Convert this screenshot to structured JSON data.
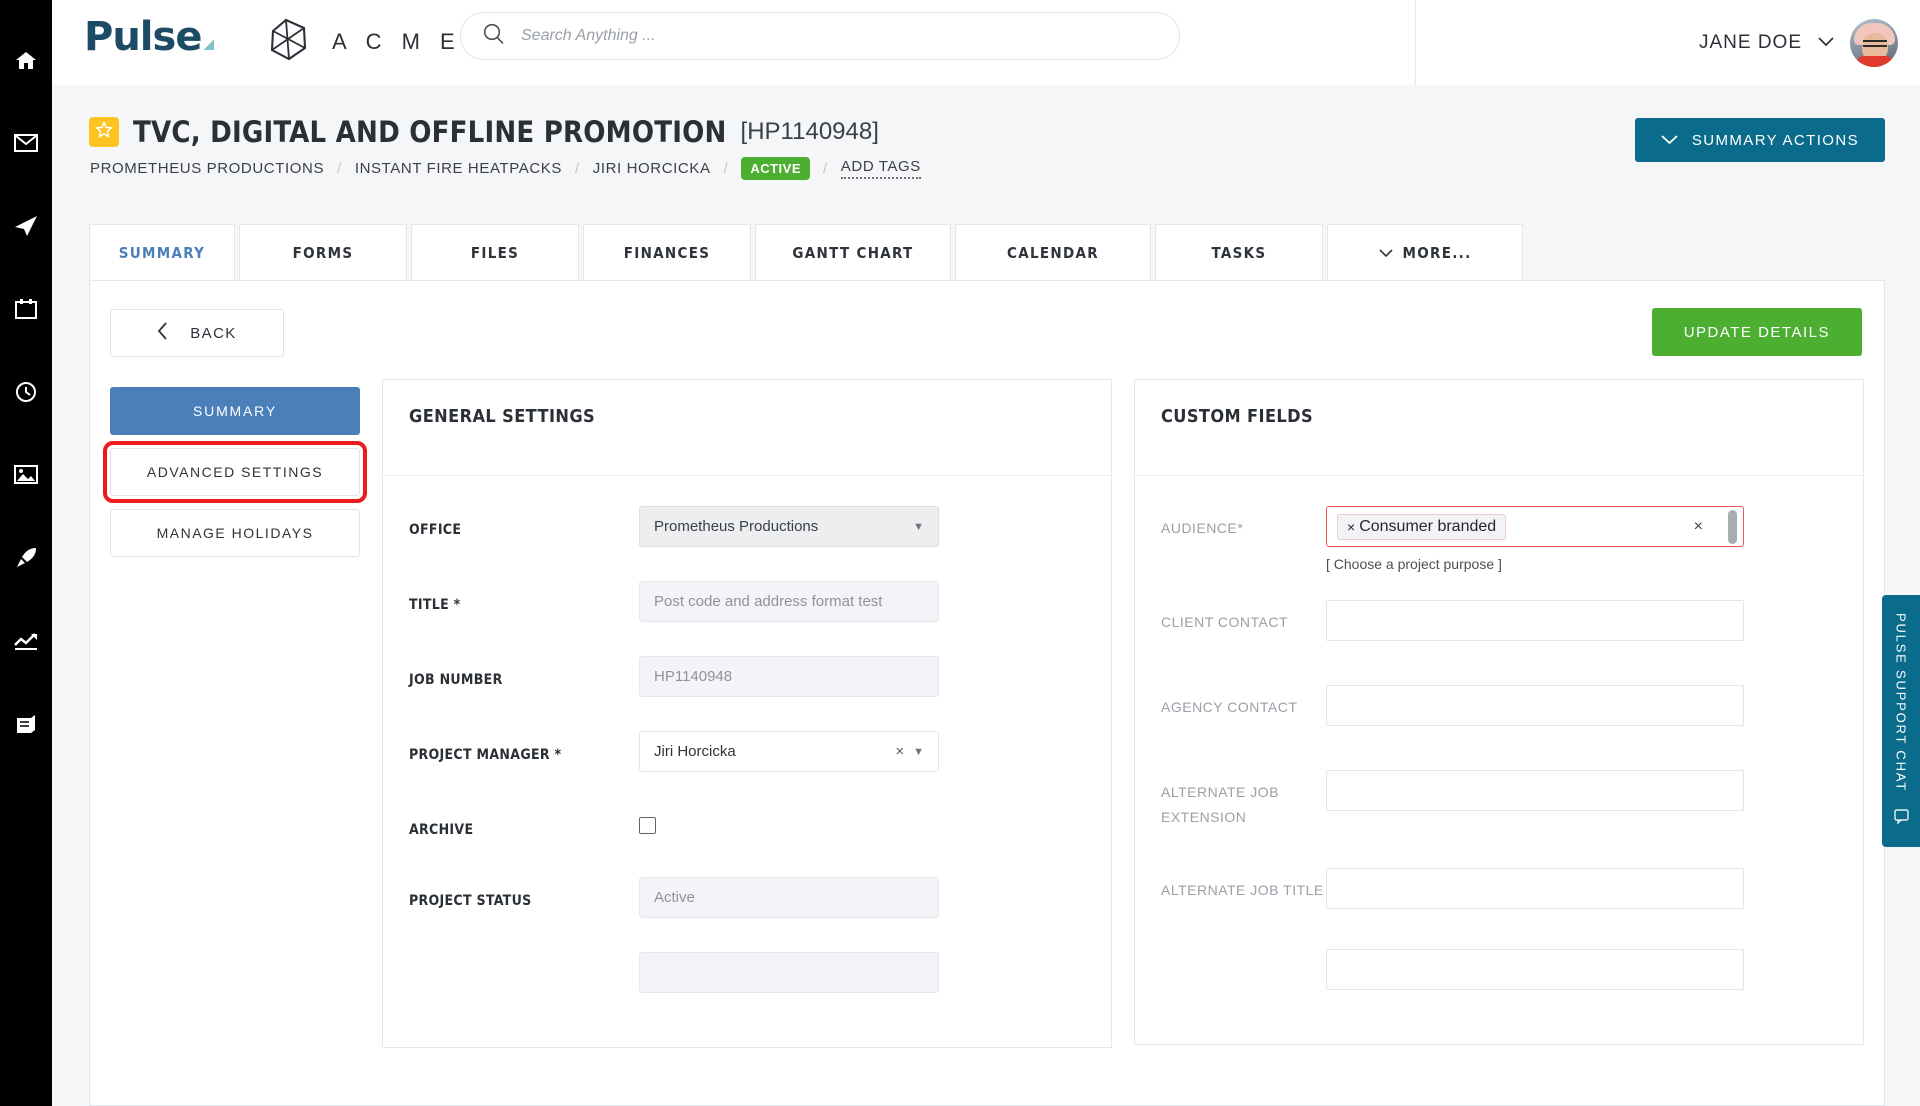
{
  "rail": {
    "items": [
      {
        "name": "home-icon",
        "label": "Home"
      },
      {
        "name": "mail-icon",
        "label": "Mail"
      },
      {
        "name": "send-icon",
        "label": "Send"
      },
      {
        "name": "calendar-icon",
        "label": "Calendar"
      },
      {
        "name": "timer-icon",
        "label": "Timer"
      },
      {
        "name": "image-icon",
        "label": "Media"
      },
      {
        "name": "rocket-icon",
        "label": "Launch"
      },
      {
        "name": "chart-icon",
        "label": "Reports"
      },
      {
        "name": "book-icon",
        "label": "Library"
      }
    ]
  },
  "topbar": {
    "logo_text": "Pulse",
    "brand_name": "A C M E",
    "brand_icon": "polyhedron-logo",
    "search": {
      "placeholder": "Search Anything ...",
      "value": "",
      "icon": "search-icon"
    },
    "user": {
      "name": "JANE DOE",
      "chevron": "chevron-down-icon",
      "avatar": "user-avatar"
    }
  },
  "page_header": {
    "star_icon": "star-icon",
    "title": "TVC, DIGITAL AND OFFLINE PROMOTION",
    "code": "[HP1140948]",
    "breadcrumbs": [
      {
        "label": "PROMETHEUS PRODUCTIONS",
        "type": "link"
      },
      {
        "label": "INSTANT FIRE HEATPACKS",
        "type": "link"
      },
      {
        "label": "JIRI HORCICKA",
        "type": "link"
      },
      {
        "label": "ACTIVE",
        "type": "badge"
      },
      {
        "label": "ADD TAGS",
        "type": "dotted-link"
      }
    ],
    "separator": "/",
    "badge_color": "#4caf32",
    "summary_actions": {
      "label": "SUMMARY ACTIONS",
      "icon": "chevron-down-icon",
      "color": "#0a6c8a"
    }
  },
  "tabs": [
    {
      "label": "SUMMARY",
      "active": true
    },
    {
      "label": "FORMS",
      "active": false
    },
    {
      "label": "FILES",
      "active": false
    },
    {
      "label": "FINANCES",
      "active": false
    },
    {
      "label": "GANTT CHART",
      "active": false
    },
    {
      "label": "CALENDAR",
      "active": false
    },
    {
      "label": "TASKS",
      "active": false
    },
    {
      "label": "MORE...",
      "active": false,
      "icon": "chevron-down-icon"
    }
  ],
  "toolbar": {
    "back_label": "BACK",
    "back_icon": "chevron-left-icon",
    "update_label": "UPDATE DETAILS",
    "update_color": "#4caf32"
  },
  "side_menu": {
    "items": [
      {
        "label": "SUMMARY",
        "state": "active"
      },
      {
        "label": "ADVANCED SETTINGS",
        "state": "highlighted"
      },
      {
        "label": "MANAGE HOLIDAYS",
        "state": "default"
      }
    ],
    "highlight_color": "#ef1b1b",
    "active_color": "#4a7fba"
  },
  "general_settings": {
    "title": "GENERAL SETTINGS",
    "fields": [
      {
        "label": "OFFICE",
        "type": "select",
        "value": "Prometheus Productions",
        "required": false
      },
      {
        "label": "TITLE *",
        "type": "text",
        "value": "",
        "placeholder": "Post code and address format test",
        "required": true
      },
      {
        "label": "JOB NUMBER",
        "type": "text",
        "value": "",
        "placeholder": "HP1140948",
        "required": false
      },
      {
        "label": "PROJECT MANAGER *",
        "type": "select-clearable",
        "value": "Jiri Horcicka",
        "required": true
      },
      {
        "label": "ARCHIVE",
        "type": "checkbox",
        "checked": false
      },
      {
        "label": "PROJECT STATUS",
        "type": "text",
        "value": "",
        "placeholder": "Active",
        "required": false
      },
      {
        "label": "",
        "type": "text",
        "value": "",
        "placeholder": "",
        "required": false
      }
    ]
  },
  "custom_fields": {
    "title": "CUSTOM FIELDS",
    "fields": [
      {
        "label": "AUDIENCE*",
        "type": "multiselect",
        "tags": [
          "Consumer branded"
        ],
        "hint": "[ Choose a project purpose ]",
        "error": true
      },
      {
        "label": "CLIENT CONTACT",
        "type": "text",
        "value": ""
      },
      {
        "label": "AGENCY CONTACT",
        "type": "text",
        "value": ""
      },
      {
        "label": "ALTERNATE JOB EXTENSION",
        "type": "text",
        "value": ""
      },
      {
        "label": "ALTERNATE JOB TITLE",
        "type": "text",
        "value": ""
      },
      {
        "label": "",
        "type": "text",
        "value": ""
      }
    ],
    "error_color": "#e85a5a"
  },
  "chat_tab": {
    "label": "PULSE SUPPORT CHAT",
    "icon": "chat-icon",
    "color": "#0a6c8a"
  }
}
